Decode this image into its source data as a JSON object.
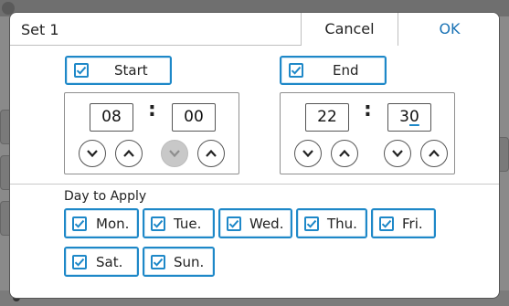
{
  "dialog": {
    "title": "Set 1",
    "cancel_label": "Cancel",
    "ok_label": "OK"
  },
  "start": {
    "label": "Start",
    "checked": true,
    "hour": "08",
    "minute": "00"
  },
  "end": {
    "label": "End",
    "checked": true,
    "hour": "22",
    "minute_first": "3",
    "minute_cursor_char": "0"
  },
  "time_separator": ":",
  "days": {
    "heading": "Day to Apply",
    "items": [
      {
        "label": "Mon.",
        "checked": true
      },
      {
        "label": "Tue.",
        "checked": true
      },
      {
        "label": "Wed.",
        "checked": true
      },
      {
        "label": "Thu.",
        "checked": true
      },
      {
        "label": "Fri.",
        "checked": true
      },
      {
        "label": "Sat.",
        "checked": true
      },
      {
        "label": "Sun.",
        "checked": true
      }
    ]
  },
  "colors": {
    "accent": "#1e88c8",
    "ok_text": "#1a73b5",
    "disabled_button": "#c8c8c8"
  },
  "icons": {
    "checkbox": "check-icon",
    "increment": "chevron-up-icon",
    "decrement": "chevron-down-icon"
  }
}
